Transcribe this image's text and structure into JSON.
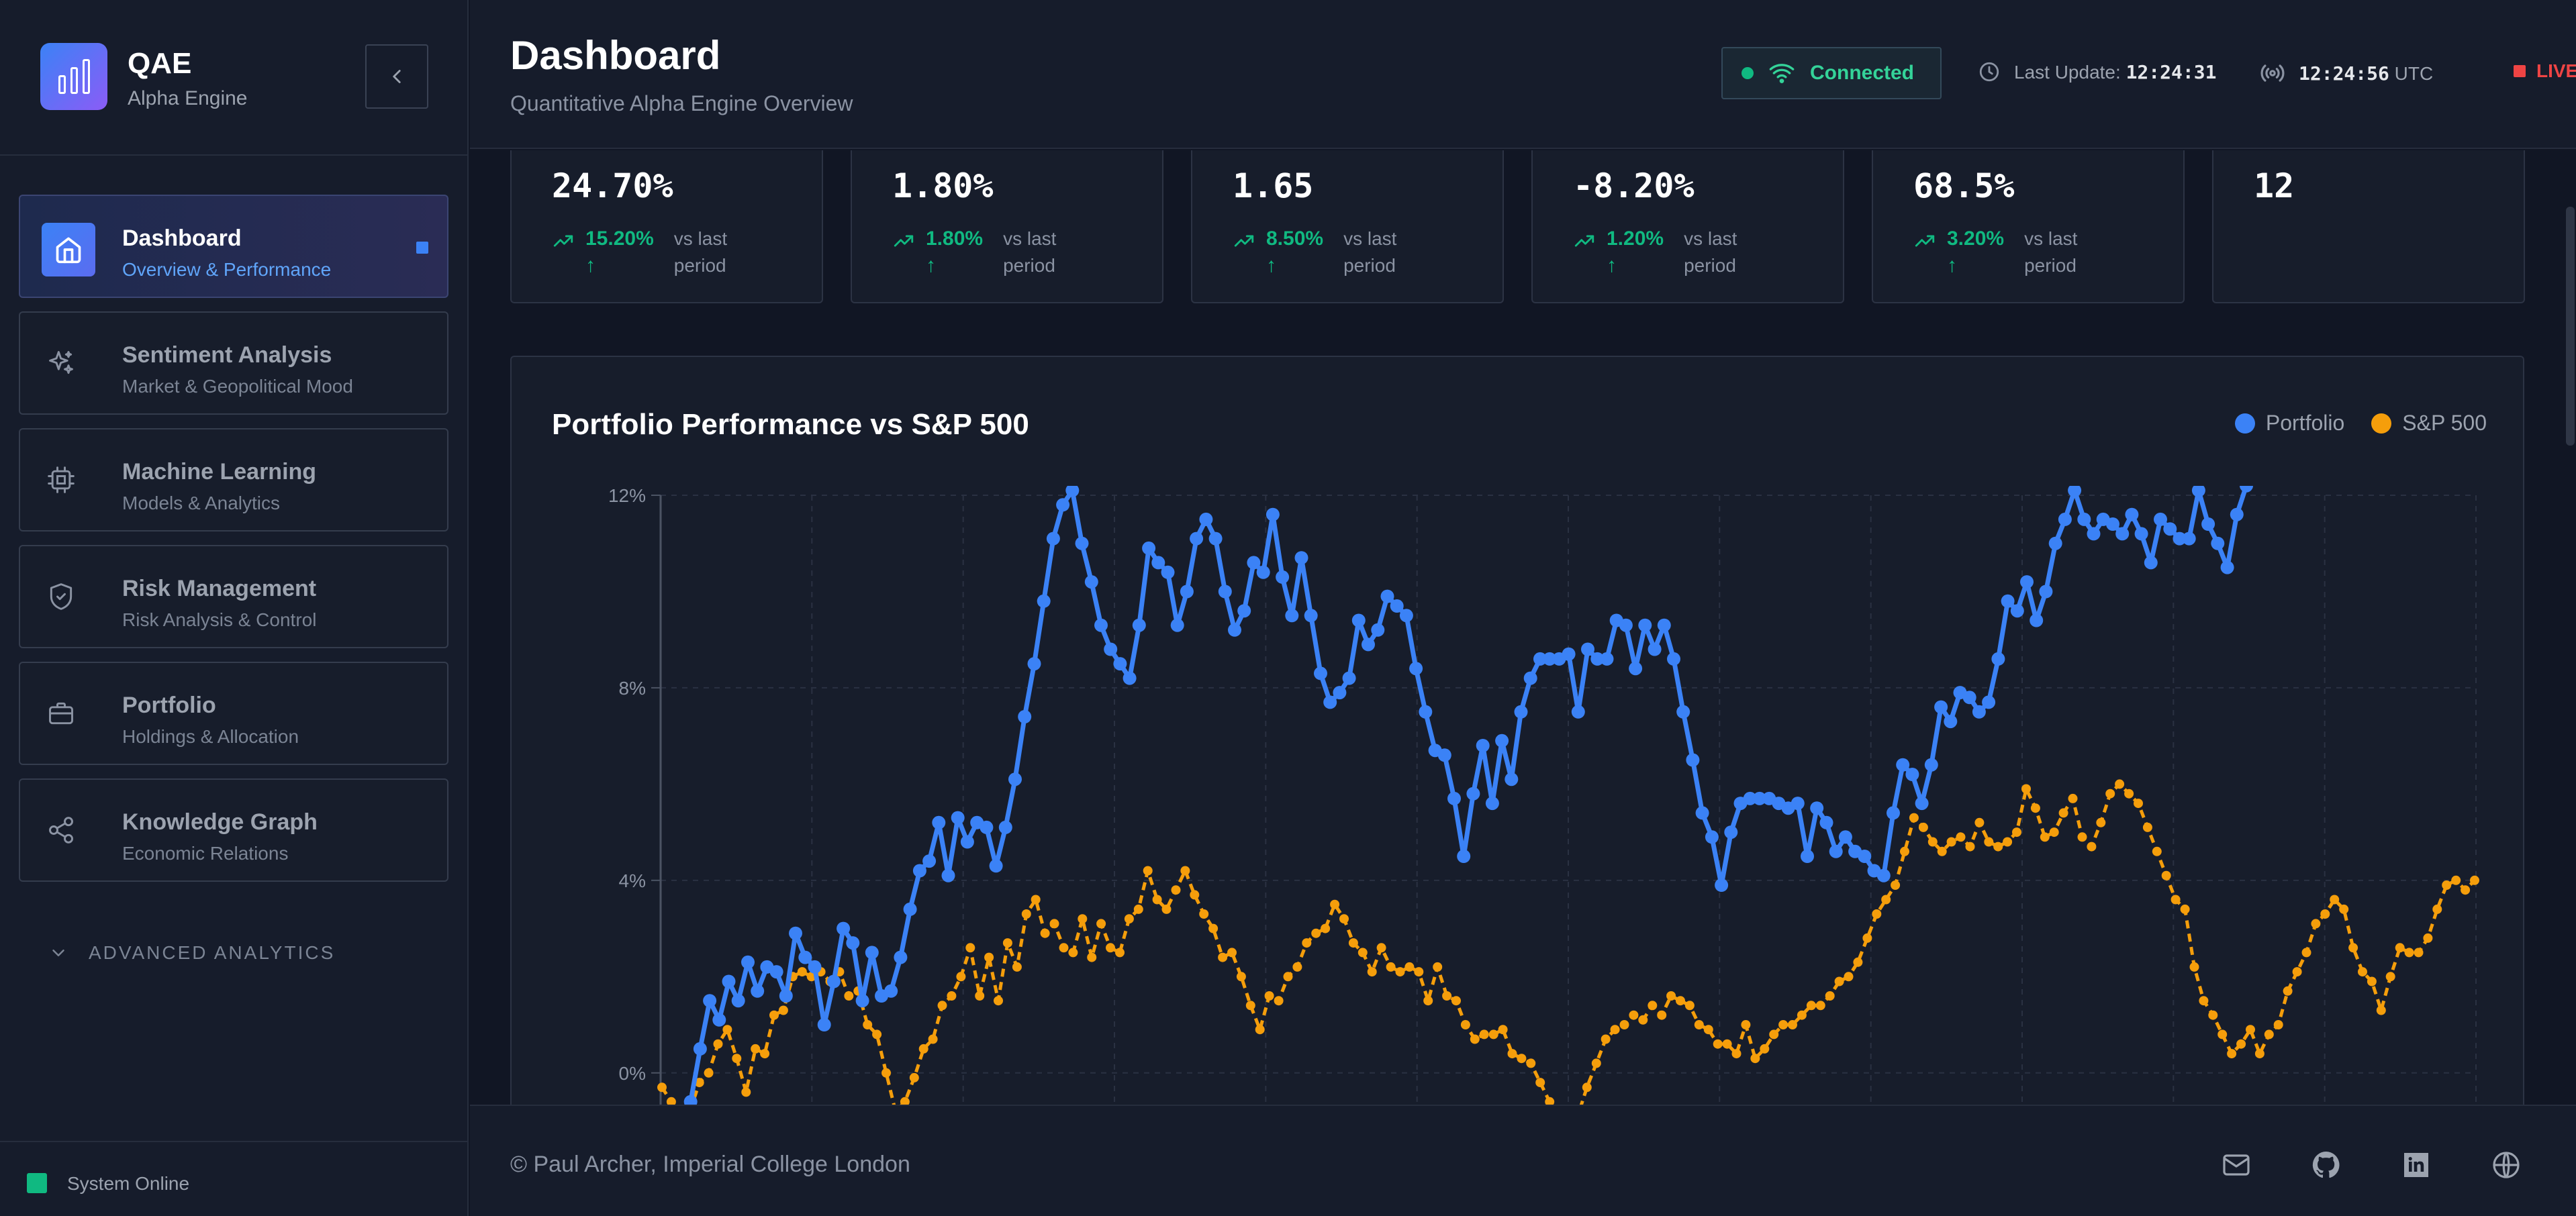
{
  "brand": {
    "title": "QAE",
    "subtitle": "Alpha Engine"
  },
  "nav": [
    {
      "title": "Dashboard",
      "subtitle": "Overview & Performance",
      "icon": "home-icon",
      "active": true
    },
    {
      "title": "Sentiment Analysis",
      "subtitle": "Market & Geopolitical Mood",
      "icon": "sparkles-icon"
    },
    {
      "title": "Machine Learning",
      "subtitle": "Models & Analytics",
      "icon": "cpu-icon"
    },
    {
      "title": "Risk Management",
      "subtitle": "Risk Analysis & Control",
      "icon": "shield-check-icon"
    },
    {
      "title": "Portfolio",
      "subtitle": "Holdings & Allocation",
      "icon": "briefcase-icon"
    },
    {
      "title": "Knowledge Graph",
      "subtitle": "Economic Relations",
      "icon": "share-icon"
    }
  ],
  "advanced_label": "ADVANCED ANALYTICS",
  "system_status": "System Online",
  "header": {
    "title": "Dashboard",
    "subtitle": "Quantitative Alpha Engine Overview",
    "connection": "Connected",
    "last_update_label": "Last Update:",
    "last_update_time": "12:24:31",
    "utc_time": "12:24:56",
    "utc_label": "UTC",
    "live": "LIVE"
  },
  "metrics": [
    {
      "value": "24.70%",
      "change": "15.20%",
      "compare": "vs last period"
    },
    {
      "value": "1.80%",
      "change": "1.80%",
      "compare": "vs last period"
    },
    {
      "value": "1.65",
      "change": "8.50%",
      "compare": "vs last period"
    },
    {
      "value": "-8.20%",
      "change": "1.20%",
      "compare": "vs last period"
    },
    {
      "value": "68.5%",
      "change": "3.20%",
      "compare": "vs last period"
    },
    {
      "value": "12"
    }
  ],
  "chart_data": {
    "type": "line",
    "title": "Portfolio Performance vs S&P 500",
    "y_ticks": [
      "12%",
      "8%",
      "4%",
      "0%"
    ],
    "ylim_visible": [
      -1.3,
      12
    ],
    "grid": true,
    "legend_position": "top-right",
    "series": [
      {
        "name": "Portfolio",
        "color": "#3b82f6",
        "values": [
          -1.0,
          -0.8,
          -1.3,
          -0.6,
          0.5,
          1.5,
          1.1,
          1.9,
          1.5,
          2.3,
          1.7,
          2.2,
          2.1,
          1.6,
          2.9,
          2.4,
          2.2,
          1.0,
          1.9,
          3.0,
          2.7,
          1.5,
          2.5,
          1.6,
          1.7,
          2.4,
          3.4,
          4.2,
          4.4,
          5.2,
          4.1,
          5.3,
          4.8,
          5.2,
          5.1,
          4.3,
          5.1,
          6.1,
          7.4,
          8.5,
          9.8,
          11.1,
          11.8,
          12.1,
          11.0,
          10.2,
          9.3,
          8.8,
          8.5,
          8.2,
          9.3,
          10.9,
          10.6,
          10.4,
          9.3,
          10.0,
          11.1,
          11.5,
          11.1,
          10.0,
          9.2,
          9.6,
          10.6,
          10.4,
          11.6,
          10.3,
          9.5,
          10.7,
          9.5,
          8.3,
          7.7,
          7.9,
          8.2,
          9.4,
          8.9,
          9.2,
          9.9,
          9.7,
          9.5,
          8.4,
          7.5,
          6.7,
          6.6,
          5.7,
          4.5,
          5.8,
          6.8,
          5.6,
          6.9,
          6.1,
          7.5,
          8.2,
          8.6,
          8.6,
          8.6,
          8.7,
          7.5,
          8.8,
          8.6,
          8.6,
          9.4,
          9.3,
          8.4,
          9.3,
          8.8,
          9.3,
          8.6,
          7.5,
          6.5,
          5.4,
          4.9,
          3.9,
          5.0,
          5.6,
          5.7,
          5.7,
          5.7,
          5.6,
          5.5,
          5.6,
          4.5,
          5.5,
          5.2,
          4.6,
          4.9,
          4.6,
          4.5,
          4.2,
          4.1,
          5.4,
          6.4,
          6.2,
          5.6,
          6.4,
          7.6,
          7.3,
          7.9,
          7.8,
          7.5,
          7.7,
          8.6,
          9.8,
          9.6,
          10.2,
          9.4,
          10.0,
          11.0,
          11.5,
          12.1,
          11.5,
          11.2,
          11.5,
          11.4,
          11.2,
          11.6,
          11.2,
          10.6,
          11.5,
          11.3,
          11.1,
          11.1,
          12.1,
          11.4,
          11.0,
          10.5,
          11.6,
          12.2
        ]
      },
      {
        "name": "S&P 500",
        "color": "#f59e0b",
        "values": [
          -0.3,
          -0.6,
          -0.8,
          -0.8,
          -0.2,
          0.0,
          0.6,
          0.9,
          0.3,
          -0.4,
          0.5,
          0.4,
          1.2,
          1.3,
          2.0,
          2.1,
          2.0,
          2.1,
          1.9,
          2.1,
          1.6,
          1.7,
          1.0,
          0.8,
          0.0,
          -0.8,
          -0.6,
          -0.1,
          0.5,
          0.7,
          1.4,
          1.6,
          2.0,
          2.6,
          1.6,
          2.4,
          1.5,
          2.7,
          2.2,
          3.3,
          3.6,
          2.9,
          3.1,
          2.6,
          2.5,
          3.2,
          2.4,
          3.1,
          2.6,
          2.5,
          3.2,
          3.4,
          4.2,
          3.6,
          3.4,
          3.8,
          4.2,
          3.7,
          3.3,
          3.0,
          2.4,
          2.5,
          2.0,
          1.4,
          0.9,
          1.6,
          1.5,
          2.0,
          2.2,
          2.7,
          2.9,
          3.0,
          3.5,
          3.2,
          2.7,
          2.5,
          2.1,
          2.6,
          2.2,
          2.1,
          2.2,
          2.1,
          1.5,
          2.2,
          1.6,
          1.5,
          1.0,
          0.7,
          0.8,
          0.8,
          0.9,
          0.4,
          0.3,
          0.2,
          -0.2,
          -0.6,
          -0.9,
          -1.2,
          -0.9,
          -0.3,
          0.2,
          0.7,
          0.9,
          1.0,
          1.2,
          1.1,
          1.4,
          1.2,
          1.6,
          1.5,
          1.4,
          1.0,
          0.9,
          0.6,
          0.6,
          0.4,
          1.0,
          0.3,
          0.5,
          0.8,
          1.0,
          1.0,
          1.2,
          1.4,
          1.4,
          1.6,
          1.9,
          2.0,
          2.3,
          2.8,
          3.3,
          3.6,
          3.9,
          4.6,
          5.3,
          5.1,
          4.8,
          4.6,
          4.8,
          4.9,
          4.7,
          5.2,
          4.8,
          4.7,
          4.8,
          5.0,
          5.9,
          5.5,
          4.9,
          5.0,
          5.4,
          5.7,
          4.9,
          4.7,
          5.2,
          5.8,
          6.0,
          5.8,
          5.6,
          5.1,
          4.6,
          4.1,
          3.6,
          3.4,
          2.2,
          1.5,
          1.2,
          0.8,
          0.4,
          0.6,
          0.9,
          0.4,
          0.8,
          1.0,
          1.7,
          2.1,
          2.5,
          3.1,
          3.3,
          3.6,
          3.4,
          2.6,
          2.1,
          1.9,
          1.3,
          2.0,
          2.6,
          2.5,
          2.5,
          2.8,
          3.4,
          3.9,
          4.0,
          3.8,
          4.0
        ]
      }
    ]
  },
  "footer": {
    "copyright": "© Paul Archer, Imperial College London",
    "icons": [
      "mail-icon",
      "github-icon",
      "linkedin-icon",
      "globe-icon"
    ]
  }
}
